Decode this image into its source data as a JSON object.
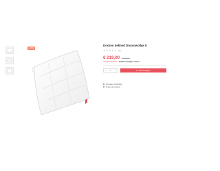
{
  "product": {
    "title": "Donzen dekbed Droomwolkje II",
    "rating_count": "(0)",
    "price": "€ 219,00",
    "old_price": "€ 299,00",
    "discount_line_prefix": "Voordeel € 80,00 ·",
    "discount_line_strong": "Gratis bezorgd & retour"
  },
  "gallery": {
    "sale_badge": "-27%"
  },
  "cart": {
    "quantity": "1",
    "add_label": "In winkelwagen"
  },
  "services": [
    {
      "label": "30 dagen bedenktijd"
    },
    {
      "label": "Gratis verzending"
    }
  ],
  "colors": {
    "accent": "#e8505b",
    "sale_badge": "#f28b6e",
    "text": "#333333"
  },
  "icons": {
    "thumb_1": "duvet-thumbnail",
    "thumb_2": "duvet-side-thumbnail",
    "thumb_3": "duvet-label-thumbnail",
    "service": "circle-check-icon"
  }
}
